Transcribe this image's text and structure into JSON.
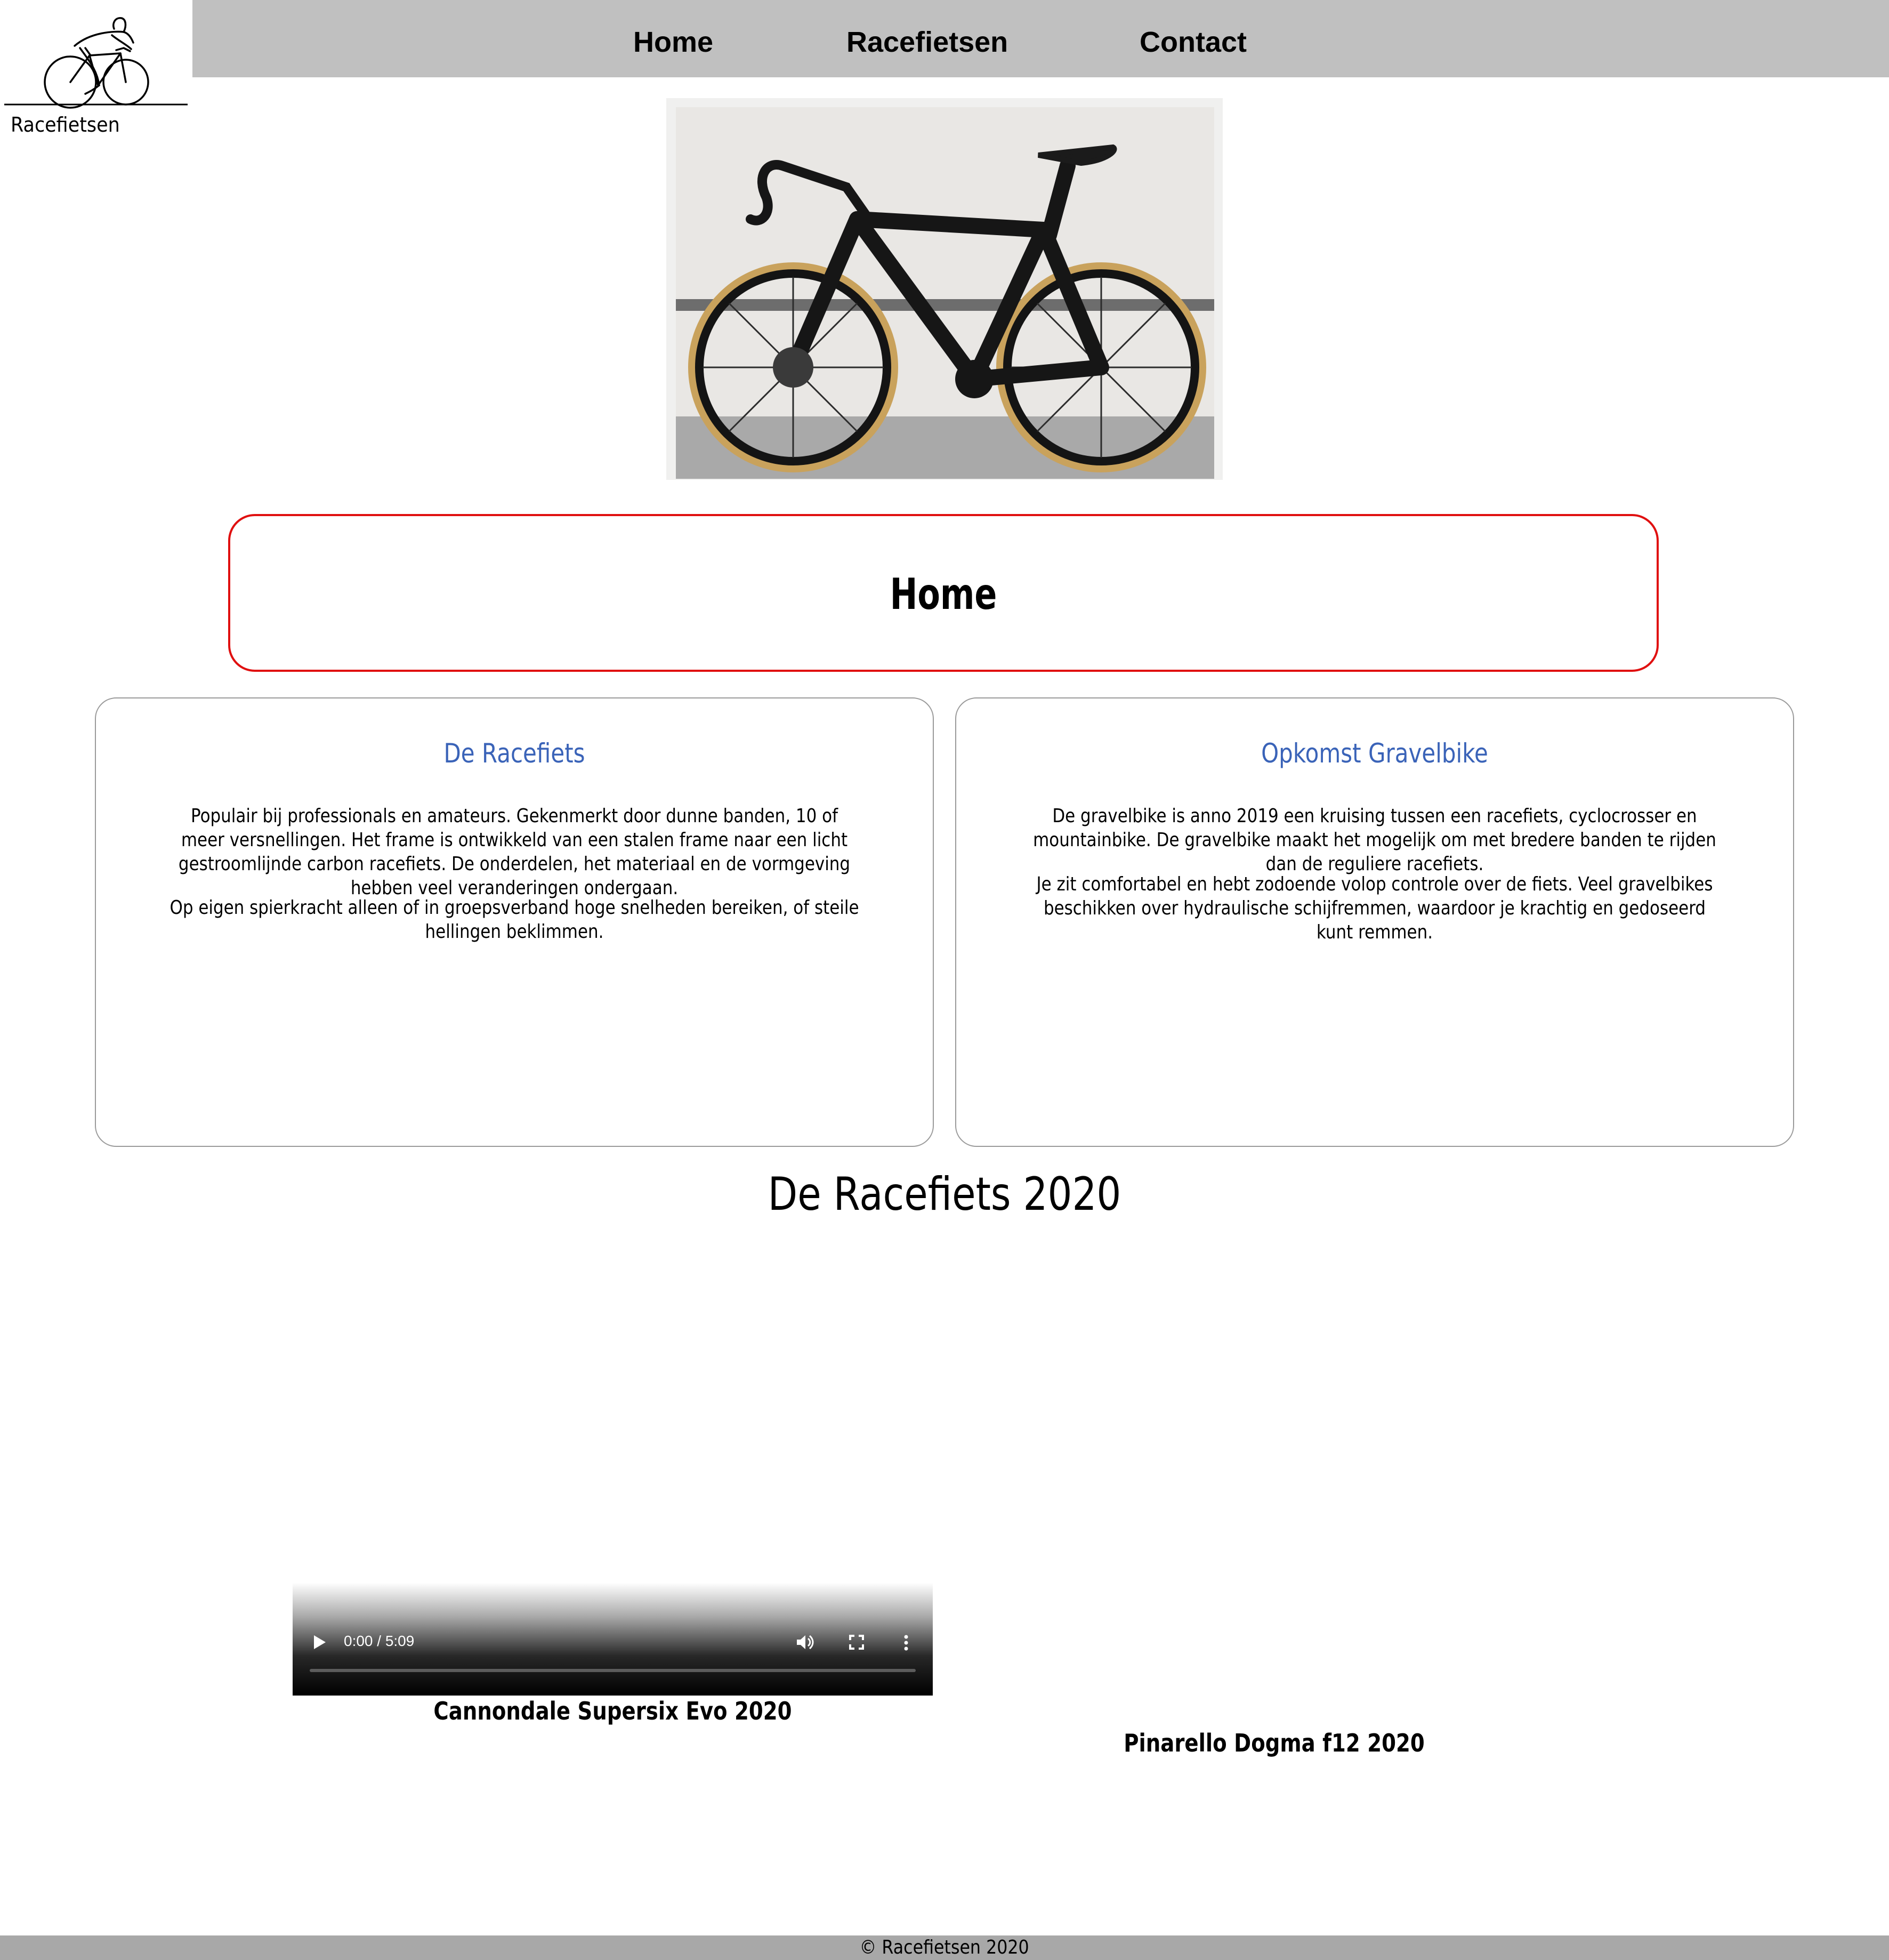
{
  "logo": {
    "text": "Racefietsen",
    "icon": "cyclist-icon"
  },
  "nav": {
    "items": [
      "Home",
      "Racefietsen",
      "Contact"
    ]
  },
  "hero": {
    "alt": "black-road-bike-photo"
  },
  "page": {
    "title": "Home"
  },
  "cards": [
    {
      "title": "De Racefiets",
      "paragraphs": [
        "Populair bij professionals en amateurs. Gekenmerkt door dunne banden, 10 of meer versnellingen. Het frame is ontwikkeld van een stalen frame naar een licht gestroomlijnde carbon racefiets. De onderdelen, het materiaal en de vormgeving hebben veel veranderingen ondergaan.",
        "Op eigen spierkracht alleen of in groepsverband hoge snelheden bereiken, of steile hellingen beklimmen."
      ]
    },
    {
      "title": "Opkomst Gravelbike",
      "paragraphs": [
        "De gravelbike is anno 2019 een kruising tussen een racefiets, cyclocrosser en mountainbike. De gravelbike maakt het mogelijk om met bredere banden te rijden dan de reguliere racefiets.",
        "Je zit comfortabel en hebt zodoende volop controle over de fiets. Veel gravelbikes beschikken over hydraulische schijfremmen, waardoor je krachtig en gedoseerd kunt remmen."
      ]
    }
  ],
  "section": {
    "title": "De Racefiets 2020"
  },
  "videos": [
    {
      "time": "0:00 / 5:09",
      "caption": "Cannondale Supersix Evo 2020"
    },
    {
      "caption": "Pinarello Dogma f12 2020"
    }
  ],
  "footer": {
    "text": "© Racefietsen 2020"
  },
  "colors": {
    "nav_bg": "#c0c0c0",
    "title_border": "#e01010",
    "card_title": "#3a63b8",
    "footer_bg": "#a8a8a8"
  }
}
